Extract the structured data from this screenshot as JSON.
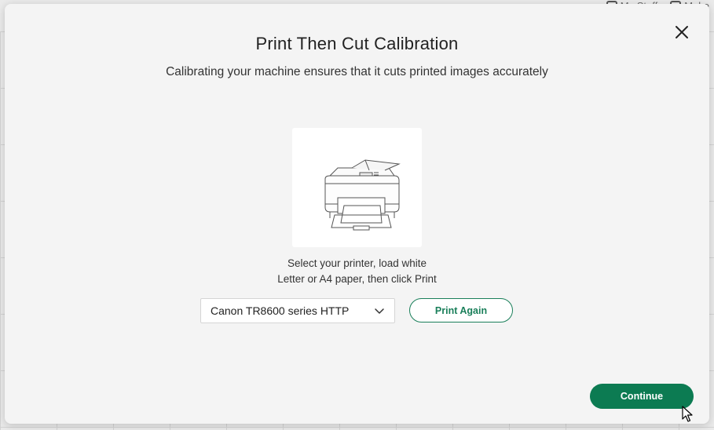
{
  "background": {
    "header_items": [
      "My Stuff",
      "Make"
    ]
  },
  "modal": {
    "title": "Print Then Cut Calibration",
    "subtitle": "Calibrating your machine ensures that it cuts printed images accurately",
    "illustration_icon": "printer-illustration",
    "instructions": {
      "line1": "Select your printer, load white",
      "line2": "Letter or A4 paper, then click Print"
    },
    "printer_select": {
      "selected": "Canon TR8600 series HTTP"
    },
    "print_again_label": "Print Again",
    "continue_label": "Continue",
    "close_icon": "close-icon"
  },
  "colors": {
    "accent": "#0c7b52",
    "modal_bg": "#f4f4f4"
  }
}
